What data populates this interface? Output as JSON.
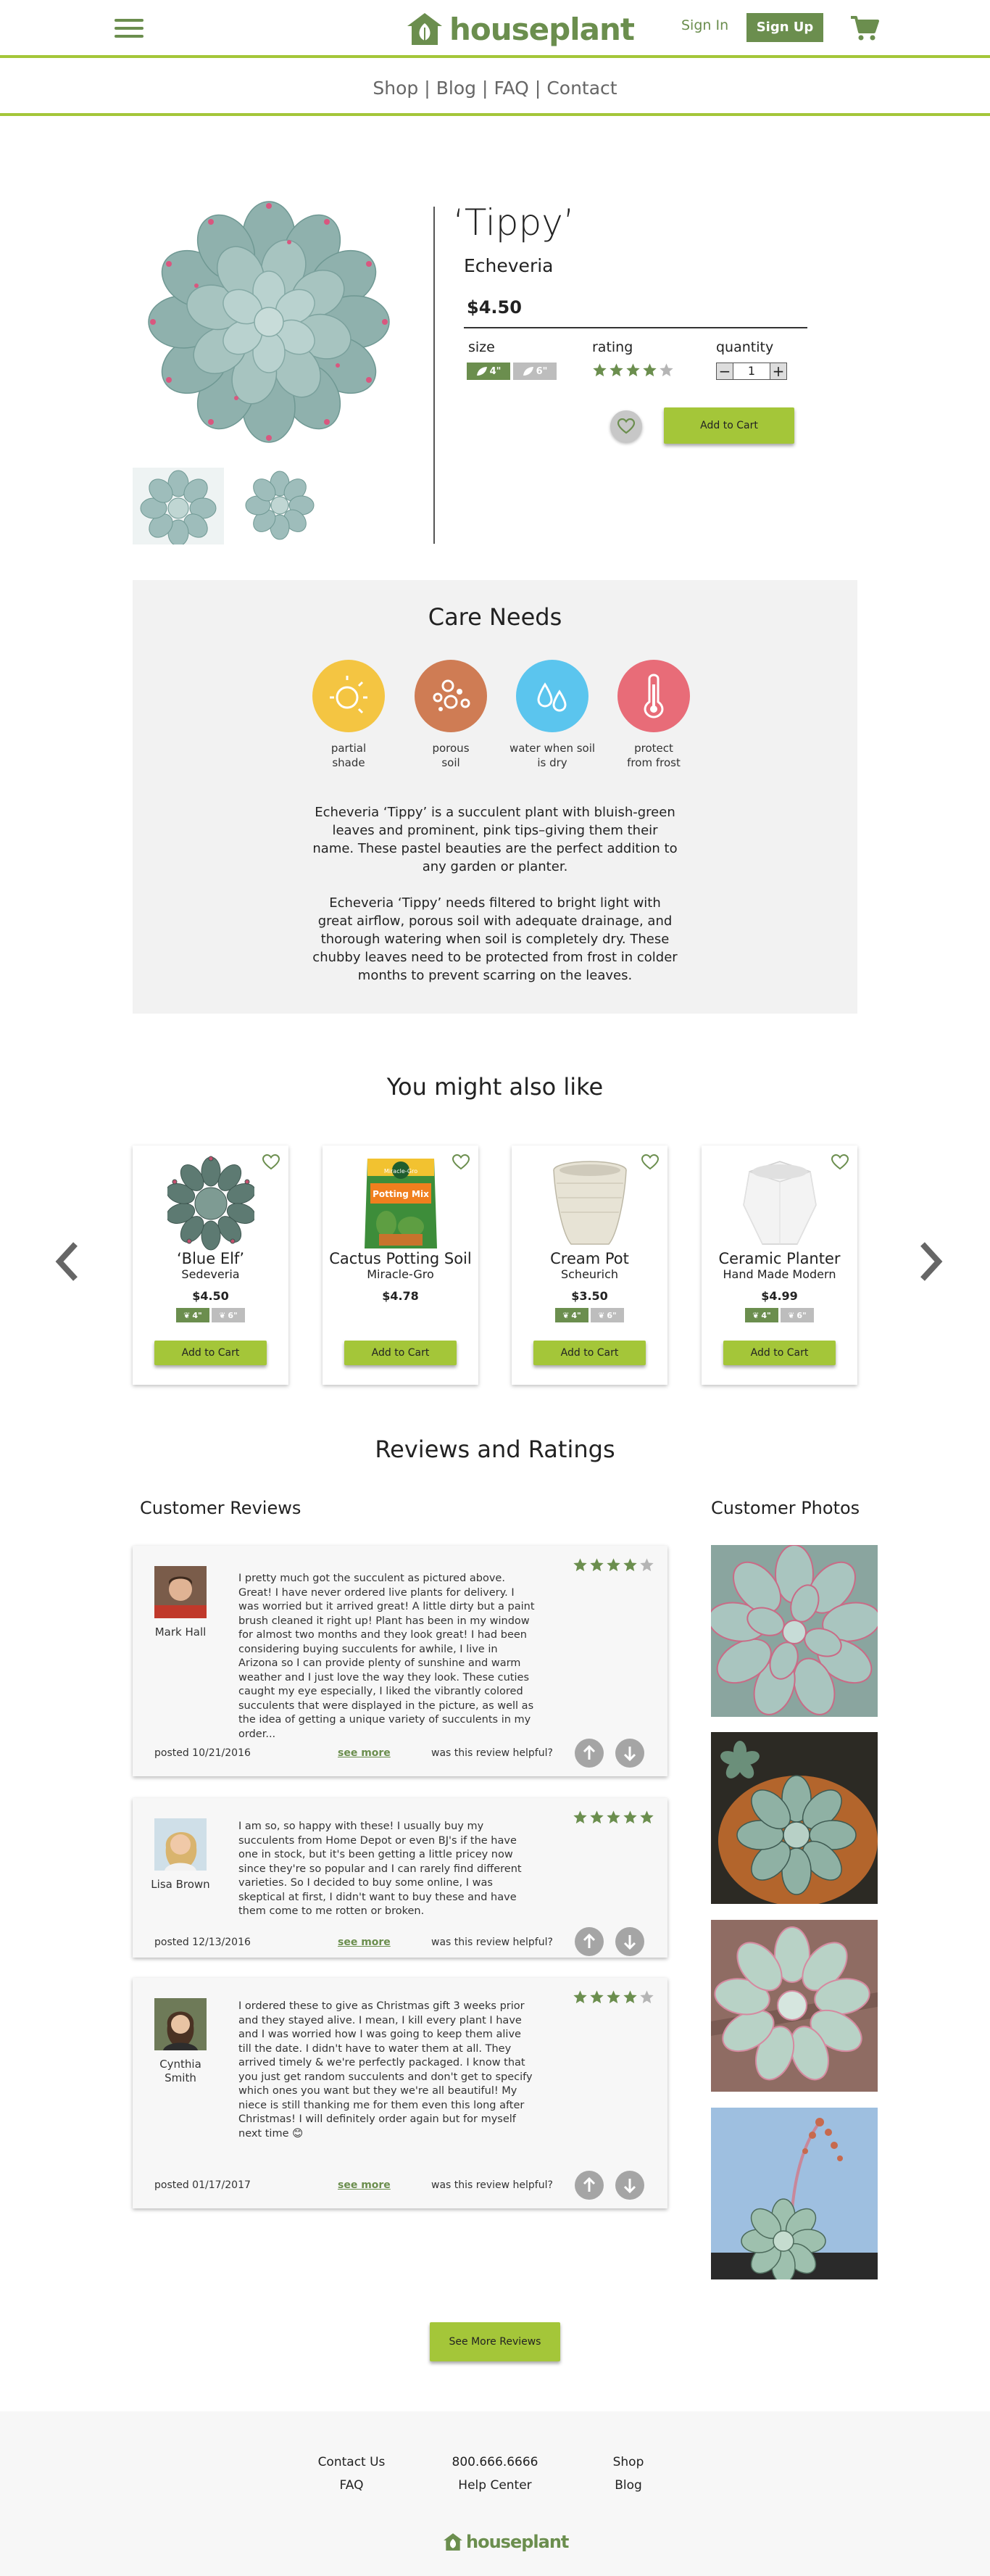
{
  "header": {
    "brand": "houseplant",
    "sign_in": "Sign In",
    "sign_up": "Sign Up",
    "brand_color": "#6b8e4e",
    "accent_color": "#a4c639"
  },
  "nav": {
    "items": [
      "Shop",
      "Blog",
      "FAQ",
      "Contact"
    ],
    "separator": "|"
  },
  "product": {
    "title": "‘Tippy’",
    "subtitle": "Echeveria",
    "price": "$4.50",
    "size_label": "size",
    "rating_label": "rating",
    "quantity_label": "quantity",
    "sizes": [
      {
        "label": "4\"",
        "selected": true
      },
      {
        "label": "6\"",
        "selected": false
      }
    ],
    "rating": 4,
    "rating_max": 5,
    "quantity": "1",
    "add_to_cart": "Add to Cart"
  },
  "care": {
    "title": "Care Needs",
    "items": [
      {
        "line1": "partial",
        "line2": "shade",
        "icon": "sun-icon",
        "color": "#f4c542"
      },
      {
        "line1": "porous",
        "line2": "soil",
        "icon": "soil-icon",
        "color": "#cf7c54"
      },
      {
        "line1": "water when soil",
        "line2": "is dry",
        "icon": "water-drops-icon",
        "color": "#5bc5ee"
      },
      {
        "line1": "protect",
        "line2": "from frost",
        "icon": "thermometer-icon",
        "color": "#e86c78"
      }
    ],
    "paragraph1": "Echeveria ‘Tippy’ is a succulent plant with bluish-green leaves and prominent, pink tips–giving them their name. These pastel beauties are the perfect addition to any garden or planter.",
    "paragraph2": "Echeveria ‘Tippy’ needs filtered to bright light with great airflow, porous soil with adequate drainage, and thorough watering when soil is completely dry. These chubby leaves need to be protected from frost in colder months to prevent scarring on the leaves."
  },
  "related": {
    "title": "You might also like",
    "products": [
      {
        "name": "‘Blue Elf’",
        "brand": "Sedeveria",
        "price": "$4.50",
        "sizes": [
          "4\"",
          "6\""
        ],
        "add": "Add to Cart"
      },
      {
        "name": "Cactus Potting Soil",
        "brand": "Miracle-Gro",
        "price": "$4.78",
        "sizes": [],
        "add": "Add to Cart",
        "bag_top": "Miracle-Gro",
        "bag_text": "Potting Mix"
      },
      {
        "name": "Cream Pot",
        "brand": "Scheurich",
        "price": "$3.50",
        "sizes": [
          "4\"",
          "6\""
        ],
        "add": "Add to Cart"
      },
      {
        "name": "Ceramic Planter",
        "brand": "Hand Made Modern",
        "price": "$4.99",
        "sizes": [
          "4\"",
          "6\""
        ],
        "add": "Add to Cart"
      }
    ]
  },
  "reviews": {
    "title": "Reviews and Ratings",
    "customer_reviews": "Customer Reviews",
    "customer_photos": "Customer Photos",
    "see_more": "see more",
    "helpful": "was this review helpful?",
    "items": [
      {
        "name": "Mark Hall",
        "rating": 4,
        "date": "posted 10/21/2016",
        "text": "I pretty much got the succulent as pictured above. Great! I have never ordered live plants for delivery. I was worried but it arrived great! A little dirty but a paint brush cleaned it right up! Plant has been in my window for almost two months and they look great! I had been considering buying succulents for awhile, I live in Arizona so I can provide plenty of sunshine and warm weather and I just love the way they look. These cuties caught my eye especially, I liked the vibrantly colored succulents that were displayed in the picture, as well as the idea of getting a unique variety of succulents in my order..."
      },
      {
        "name": "Lisa Brown",
        "rating": 5,
        "date": "posted 12/13/2016",
        "text": "I am so, so happy with these! I usually buy my succulents from Home Depot or even BJ's if the have one in stock, but it's been getting a little pricey now since they're so popular and I can rarely find different varieties. So I decided to buy some online, I was skeptical at first, I didn't want to buy these and have them come to me rotten or broken."
      },
      {
        "name": "Cynthia Smith",
        "rating": 4,
        "date": "posted 01/17/2017",
        "text": "I ordered these to give as Christmas gift 3 weeks prior and they stayed alive. I mean, I kill every plant I have and I was worried how I was going to keep them alive till the date. I didn't have to water them at all. They arrived timely & we're perfectly packaged. I know that you just get random succulents and don't get to specify which ones you want but they we're all beautiful! My niece is still thanking me for them even this long after Christmas! I will definitely order again but for myself next time 😊"
      }
    ],
    "see_more_reviews": "See More Reviews"
  },
  "footer": {
    "col1": [
      "Contact Us",
      "FAQ"
    ],
    "col2": [
      "800.666.6666",
      "Help Center"
    ],
    "col3": [
      "Shop",
      "Blog"
    ],
    "brand": "houseplant"
  }
}
